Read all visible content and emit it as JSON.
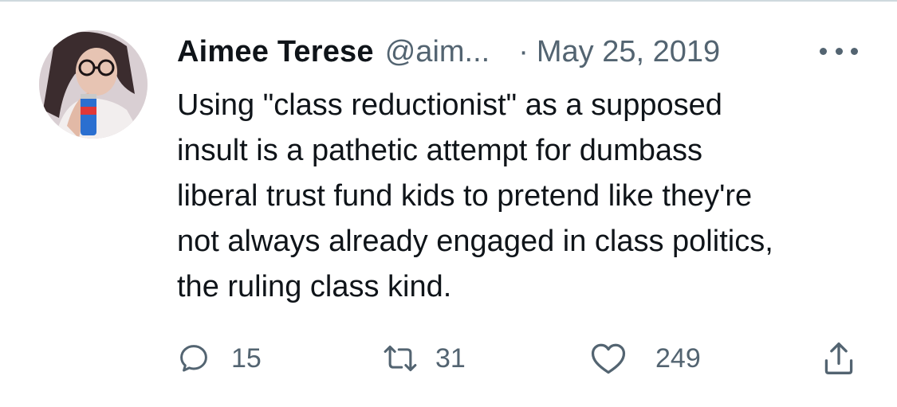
{
  "tweet": {
    "author_name": "Aimee Terese",
    "handle": "@aim...",
    "separator": "·",
    "date": "May 25, 2019",
    "text_lines": [
      "Using \"class reductionist\" as a supposed",
      "insult is a pathetic attempt for dumbass",
      "liberal trust fund kids to pretend like they're",
      "not always already engaged in class politics,",
      "the ruling class kind."
    ]
  },
  "actions": {
    "replies": "15",
    "retweets": "31",
    "likes": "249"
  },
  "icons": {
    "reply": "reply-icon",
    "retweet": "retweet-icon",
    "like": "heart-icon",
    "share": "share-icon",
    "more": "more-icon"
  },
  "colors": {
    "text_primary": "#0f1419",
    "text_secondary": "#536471",
    "divider": "#cfd9de"
  }
}
